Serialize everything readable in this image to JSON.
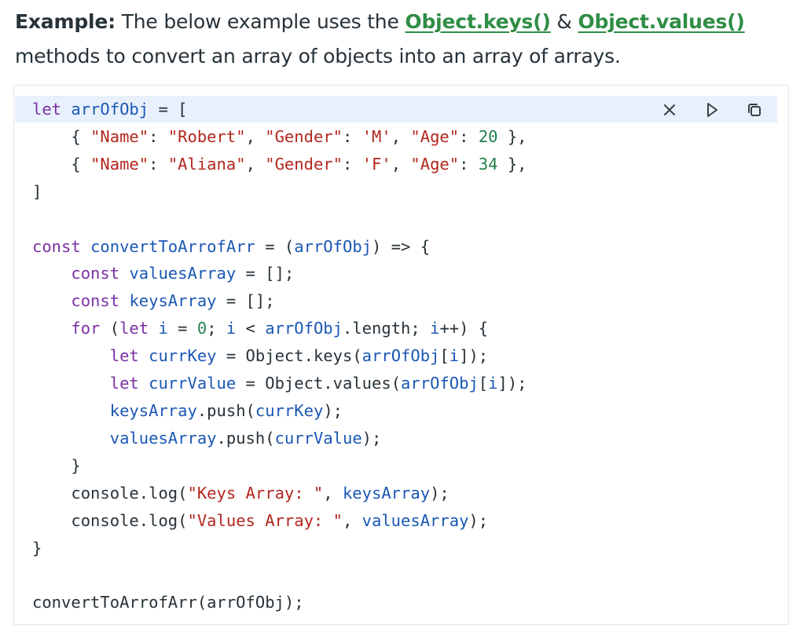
{
  "intro": {
    "label": "Example:",
    "text1": " The below example uses the ",
    "link1": "Object.keys()",
    "amp": " & ",
    "link2": "Object.values()",
    "text2": "methods to convert an array of objects into an array of arrays."
  },
  "toolbar": {
    "close_icon": "close-icon",
    "run_icon": "play-icon",
    "copy_icon": "copy-icon"
  },
  "code": {
    "lines": [
      [
        [
          "kw",
          "let "
        ],
        [
          "vr",
          "arrOfObj"
        ],
        [
          "pl",
          " = ["
        ]
      ],
      [
        [
          "pl",
          "    { "
        ],
        [
          "st",
          "\"Name\""
        ],
        [
          "pl",
          ": "
        ],
        [
          "st",
          "\"Robert\""
        ],
        [
          "pl",
          ", "
        ],
        [
          "st",
          "\"Gender\""
        ],
        [
          "pl",
          ": "
        ],
        [
          "st",
          "'M'"
        ],
        [
          "pl",
          ", "
        ],
        [
          "st",
          "\"Age\""
        ],
        [
          "pl",
          ": "
        ],
        [
          "nm",
          "20"
        ],
        [
          "pl",
          " },"
        ]
      ],
      [
        [
          "pl",
          "    { "
        ],
        [
          "st",
          "\"Name\""
        ],
        [
          "pl",
          ": "
        ],
        [
          "st",
          "\"Aliana\""
        ],
        [
          "pl",
          ", "
        ],
        [
          "st",
          "\"Gender\""
        ],
        [
          "pl",
          ": "
        ],
        [
          "st",
          "'F'"
        ],
        [
          "pl",
          ", "
        ],
        [
          "st",
          "\"Age\""
        ],
        [
          "pl",
          ": "
        ],
        [
          "nm",
          "34"
        ],
        [
          "pl",
          " },"
        ]
      ],
      [
        [
          "pl",
          "]"
        ]
      ],
      [
        [
          "pl",
          ""
        ]
      ],
      [
        [
          "kw",
          "const "
        ],
        [
          "vr",
          "convertToArrofArr"
        ],
        [
          "pl",
          " = ("
        ],
        [
          "vr",
          "arrOfObj"
        ],
        [
          "pl",
          ") => {"
        ]
      ],
      [
        [
          "pl",
          "    "
        ],
        [
          "kw",
          "const "
        ],
        [
          "vr",
          "valuesArray"
        ],
        [
          "pl",
          " = [];"
        ]
      ],
      [
        [
          "pl",
          "    "
        ],
        [
          "kw",
          "const "
        ],
        [
          "vr",
          "keysArray"
        ],
        [
          "pl",
          " = [];"
        ]
      ],
      [
        [
          "pl",
          "    "
        ],
        [
          "kw",
          "for "
        ],
        [
          "pl",
          "("
        ],
        [
          "kw",
          "let "
        ],
        [
          "vr",
          "i"
        ],
        [
          "pl",
          " = "
        ],
        [
          "nm",
          "0"
        ],
        [
          "pl",
          "; "
        ],
        [
          "vr",
          "i"
        ],
        [
          "pl",
          " < "
        ],
        [
          "vr",
          "arrOfObj"
        ],
        [
          "pl",
          ".length; "
        ],
        [
          "vr",
          "i"
        ],
        [
          "pl",
          "++) {"
        ]
      ],
      [
        [
          "pl",
          "        "
        ],
        [
          "kw",
          "let "
        ],
        [
          "vr",
          "currKey"
        ],
        [
          "pl",
          " = Object.keys("
        ],
        [
          "vr",
          "arrOfObj"
        ],
        [
          "pl",
          "["
        ],
        [
          "vr",
          "i"
        ],
        [
          "pl",
          "]);"
        ]
      ],
      [
        [
          "pl",
          "        "
        ],
        [
          "kw",
          "let "
        ],
        [
          "vr",
          "currValue"
        ],
        [
          "pl",
          " = Object.values("
        ],
        [
          "vr",
          "arrOfObj"
        ],
        [
          "pl",
          "["
        ],
        [
          "vr",
          "i"
        ],
        [
          "pl",
          "]);"
        ]
      ],
      [
        [
          "pl",
          "        "
        ],
        [
          "vr",
          "keysArray"
        ],
        [
          "pl",
          ".push("
        ],
        [
          "vr",
          "currKey"
        ],
        [
          "pl",
          ");"
        ]
      ],
      [
        [
          "pl",
          "        "
        ],
        [
          "vr",
          "valuesArray"
        ],
        [
          "pl",
          ".push("
        ],
        [
          "vr",
          "currValue"
        ],
        [
          "pl",
          ");"
        ]
      ],
      [
        [
          "pl",
          "    }"
        ]
      ],
      [
        [
          "pl",
          "    console.log("
        ],
        [
          "st",
          "\"Keys Array: \""
        ],
        [
          "pl",
          ", "
        ],
        [
          "vr",
          "keysArray"
        ],
        [
          "pl",
          ");"
        ]
      ],
      [
        [
          "pl",
          "    console.log("
        ],
        [
          "st",
          "\"Values Array: \""
        ],
        [
          "pl",
          ", "
        ],
        [
          "vr",
          "valuesArray"
        ],
        [
          "pl",
          ");"
        ]
      ],
      [
        [
          "pl",
          "}"
        ]
      ],
      [
        [
          "pl",
          ""
        ]
      ],
      [
        [
          "pl",
          "convertToArrofArr(arrOfObj);"
        ]
      ]
    ]
  }
}
